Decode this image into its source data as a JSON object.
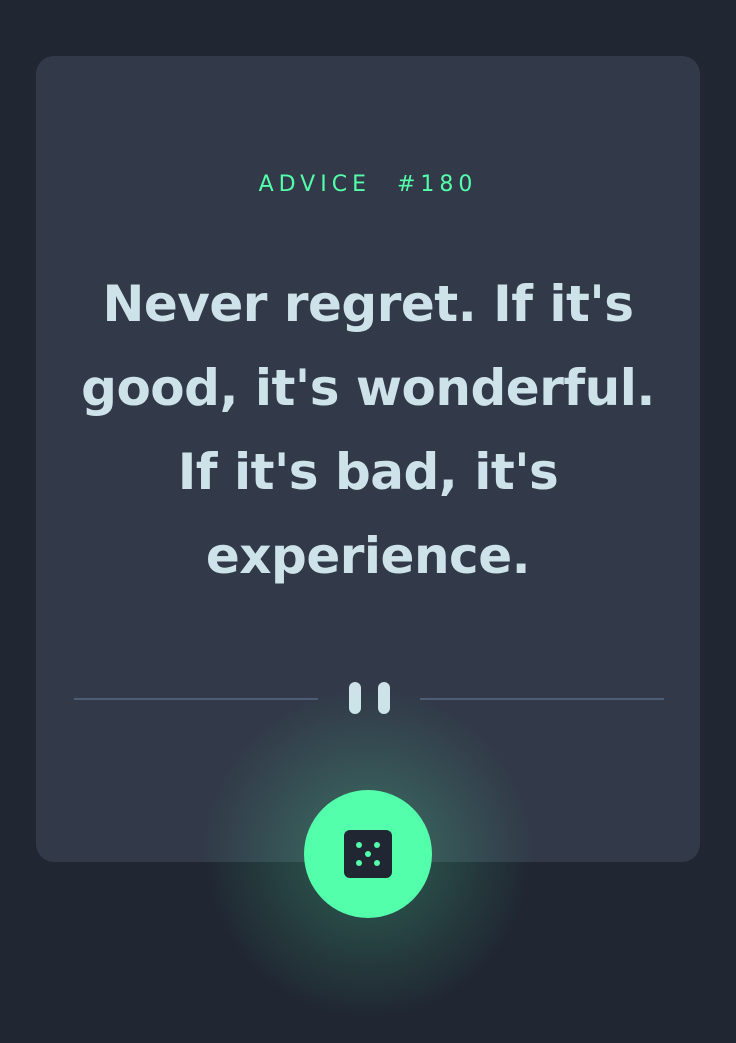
{
  "advice": {
    "label": "ADVICE",
    "number": "#180",
    "text": "Never regret. If it's good, it's wonderful. If it's bad, it's experience."
  },
  "icons": {
    "divider": "pause-icon",
    "button": "dice-icon"
  },
  "colors": {
    "background": "#202632",
    "card": "#323a49",
    "accent": "#53ffaa",
    "text": "#cee3e9",
    "divider": "#4f5d74"
  }
}
